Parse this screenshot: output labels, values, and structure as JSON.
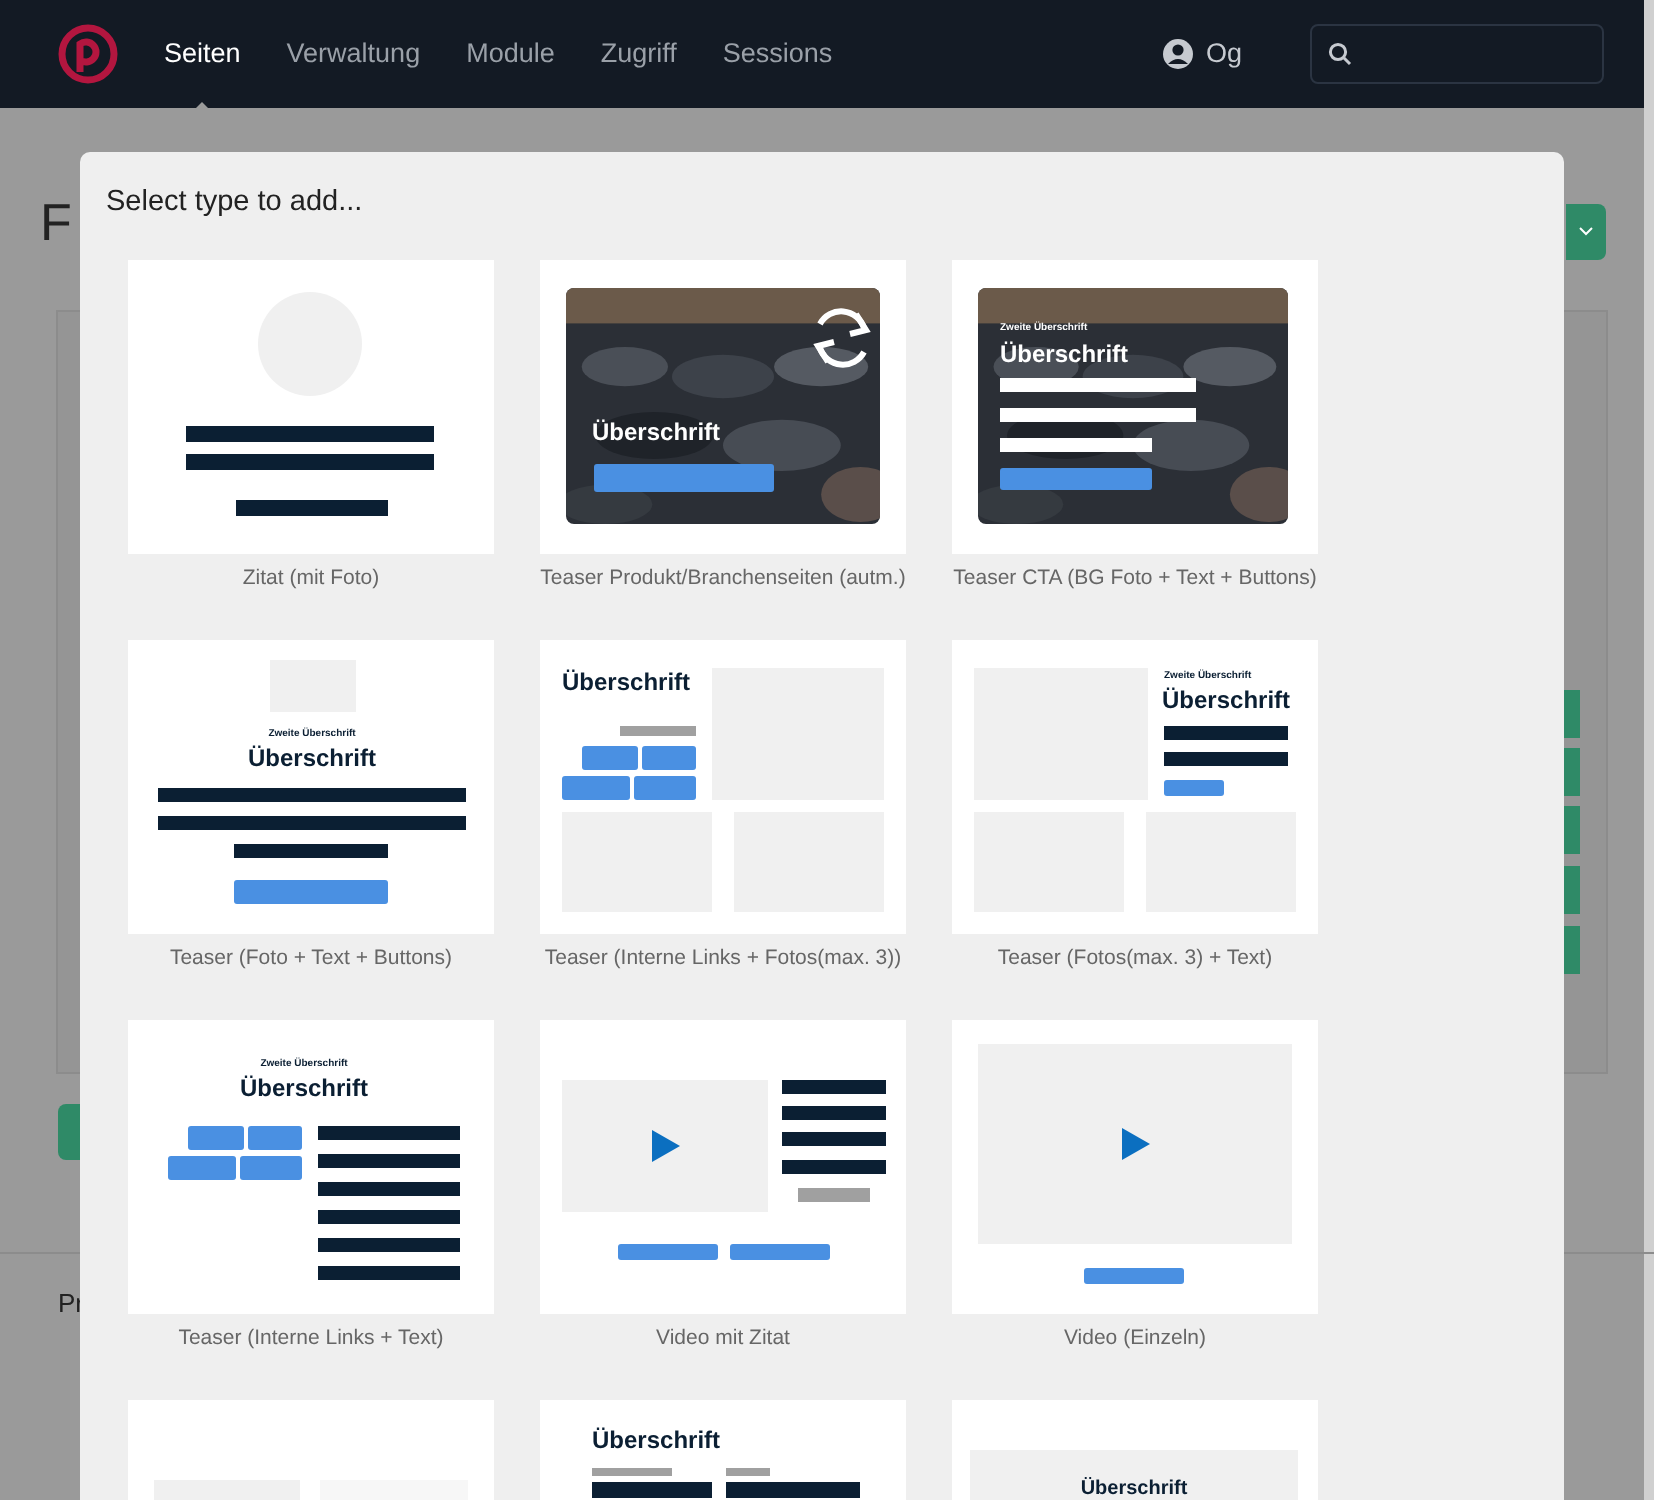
{
  "nav": {
    "items": [
      {
        "label": "Seiten",
        "selected": true
      },
      {
        "label": "Verwaltung",
        "selected": false
      },
      {
        "label": "Module",
        "selected": false
      },
      {
        "label": "Zugriff",
        "selected": false
      },
      {
        "label": "Sessions",
        "selected": false
      }
    ],
    "user": "Og"
  },
  "page": {
    "heading": "F",
    "section_label": "Pr"
  },
  "modal": {
    "title": "Select type to add...",
    "tiles": [
      {
        "kind": "quote_photo",
        "label": "Zitat (mit Foto)"
      },
      {
        "kind": "teaser_product",
        "label": "Teaser Produkt/Branchenseiten (autm.)",
        "heading": "Überschrift"
      },
      {
        "kind": "teaser_cta",
        "label": "Teaser CTA (BG Foto + Text + Buttons)",
        "subheading": "Zweite Überschrift",
        "heading": "Überschrift"
      },
      {
        "kind": "teaser_photo_text_buttons",
        "label": "Teaser (Foto + Text + Buttons)",
        "subheading": "Zweite Überschrift",
        "heading": "Überschrift"
      },
      {
        "kind": "teaser_links_photos",
        "label": "Teaser (Interne Links + Fotos(max. 3))",
        "heading": "Überschrift"
      },
      {
        "kind": "teaser_photos_text",
        "label": "Teaser (Fotos(max. 3) + Text)",
        "subheading": "Zweite Überschrift",
        "heading": "Überschrift"
      },
      {
        "kind": "teaser_links_text",
        "label": "Teaser (Interne Links + Text)",
        "subheading": "Zweite Überschrift",
        "heading": "Überschrift"
      },
      {
        "kind": "video_quote",
        "label": "Video mit Zitat"
      },
      {
        "kind": "video_single",
        "label": "Video (Einzeln)"
      },
      {
        "kind": "photo_pair"
      },
      {
        "kind": "heading_columns",
        "heading": "Überschrift"
      },
      {
        "kind": "heading_box",
        "heading": "Überschrift"
      }
    ]
  }
}
